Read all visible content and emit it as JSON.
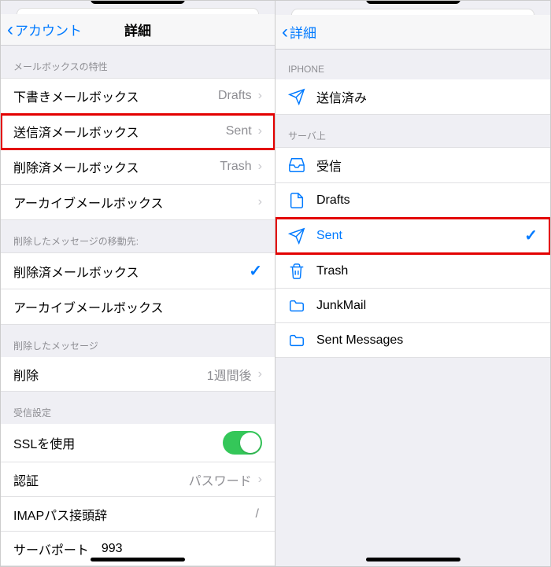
{
  "left": {
    "back_label": "アカウント",
    "title": "詳細",
    "section_mailbox": "メールボックスの特性",
    "rows_mailbox": [
      {
        "label": "下書きメールボックス",
        "value": "Drafts"
      },
      {
        "label": "送信済メールボックス",
        "value": "Sent",
        "hl": true
      },
      {
        "label": "削除済メールボックス",
        "value": "Trash"
      },
      {
        "label": "アーカイブメールボックス",
        "value": ""
      }
    ],
    "section_move": "削除したメッセージの移動先:",
    "rows_move": [
      {
        "label": "削除済メールボックス",
        "checked": true
      },
      {
        "label": "アーカイブメールボックス",
        "checked": false
      }
    ],
    "section_deleted": "削除したメッセージ",
    "row_delete": {
      "label": "削除",
      "value": "1週間後"
    },
    "section_recv": "受信設定",
    "row_ssl": {
      "label": "SSLを使用",
      "on": true
    },
    "row_auth": {
      "label": "認証",
      "value": "パスワード"
    },
    "row_prefix": {
      "label": "IMAPパス接頭辞",
      "value": "/"
    },
    "row_port": {
      "label": "サーバポート",
      "value": "993"
    }
  },
  "right": {
    "back_label": "詳細",
    "section_iphone": "IPHONE",
    "row_iphone": {
      "label": "送信済み"
    },
    "section_server": "サーバ上",
    "rows_server": [
      {
        "icon": "inbox",
        "label": "受信"
      },
      {
        "icon": "file",
        "label": "Drafts"
      },
      {
        "icon": "send",
        "label": "Sent",
        "checked": true,
        "hl": true,
        "blue": true
      },
      {
        "icon": "trash",
        "label": "Trash"
      },
      {
        "icon": "folder",
        "label": "JunkMail"
      },
      {
        "icon": "folder",
        "label": "Sent Messages"
      }
    ]
  }
}
